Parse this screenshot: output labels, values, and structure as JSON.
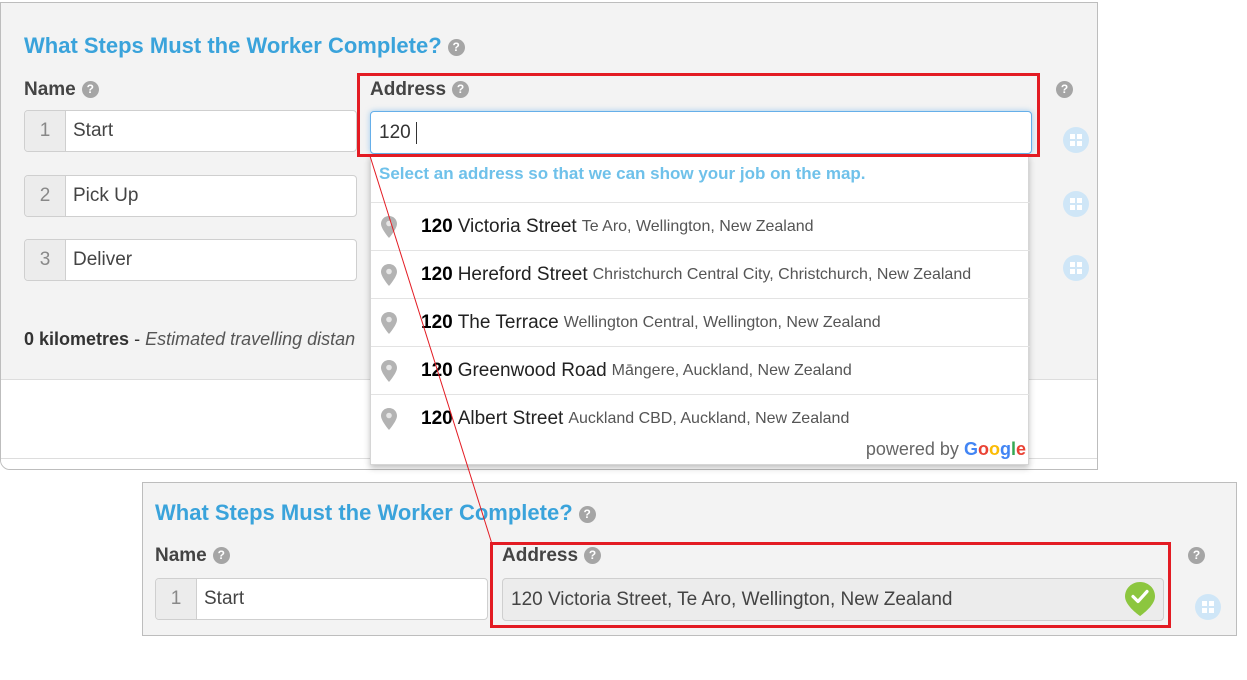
{
  "top": {
    "title": "What Steps Must the Worker Complete?",
    "name_label": "Name",
    "address_label": "Address",
    "help_glyph": "?",
    "steps": [
      {
        "num": "1",
        "name": "Start"
      },
      {
        "num": "2",
        "name": "Pick Up"
      },
      {
        "num": "3",
        "name": "Deliver"
      }
    ],
    "address_value": "120",
    "dropdown": {
      "hint": "Select an address so that we can show your job on the map.",
      "items": [
        {
          "bold": "120",
          "street": "Victoria Street",
          "secondary": "Te Aro, Wellington, New Zealand"
        },
        {
          "bold": "120",
          "street": "Hereford Street",
          "secondary": "Christchurch Central City, Christchurch, New Zealand"
        },
        {
          "bold": "120",
          "street": "The Terrace",
          "secondary": "Wellington Central, Wellington, New Zealand"
        },
        {
          "bold": "120",
          "street": "Greenwood Road",
          "secondary": "Māngere, Auckland, New Zealand"
        },
        {
          "bold": "120",
          "street": "Albert Street",
          "secondary": "Auckland CBD, Auckland, New Zealand"
        }
      ],
      "powered_by": "powered by",
      "google": [
        "G",
        "o",
        "o",
        "g",
        "l",
        "e"
      ]
    },
    "distance_value": "0 kilometres",
    "distance_sep": " - ",
    "distance_text": "Estimated travelling distan"
  },
  "bottom": {
    "title": "What Steps Must the Worker Complete?",
    "name_label": "Name",
    "address_label": "Address",
    "help_glyph": "?",
    "step": {
      "num": "1",
      "name": "Start"
    },
    "address_value": "120 Victoria Street, Te Aro, Wellington, New Zealand"
  },
  "colors": {
    "title": "#3aa3db",
    "hint": "#6fc1ea",
    "highlight": "#e31b23",
    "check": "#8cc63f",
    "google_blue": "#4285F4",
    "google_red": "#EA4335",
    "google_yellow": "#FBBC05",
    "google_green": "#34A853"
  },
  "icons": {
    "help": "help-icon",
    "grid": "grid-icon",
    "pin": "map-pin-icon",
    "check": "check-icon"
  }
}
